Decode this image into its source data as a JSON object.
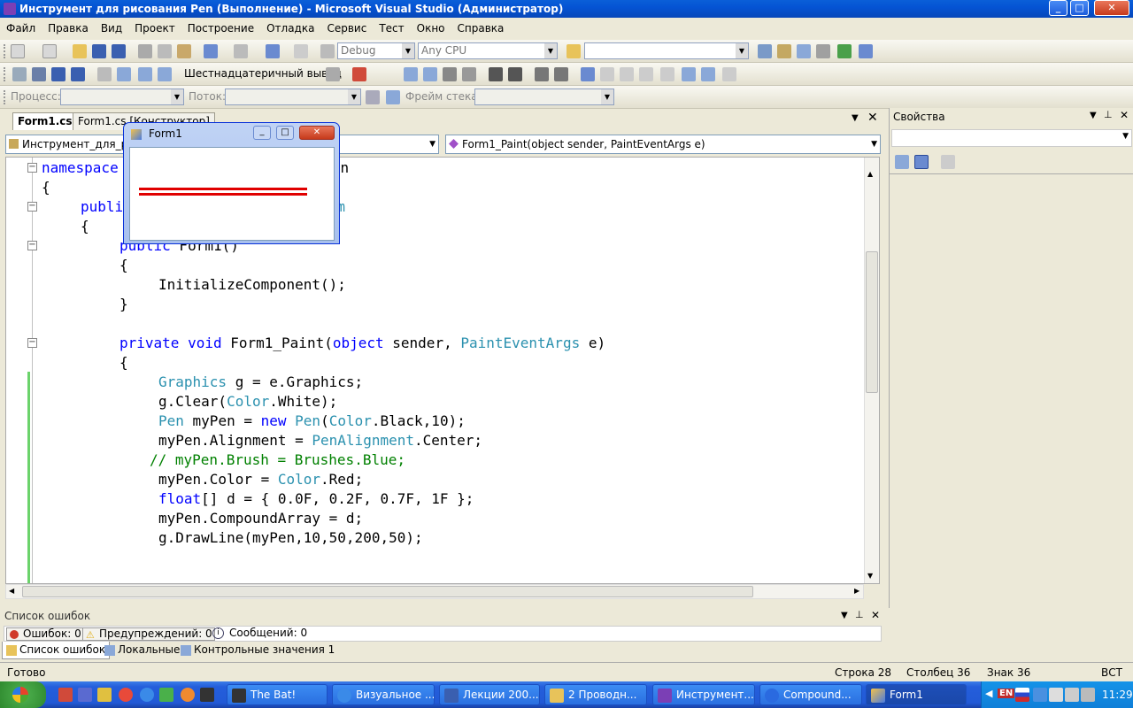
{
  "window": {
    "title": "Инструмент для рисования Pen (Выполнение) - Microsoft Visual Studio (Администратор)",
    "minimize": "_",
    "maximize": "□",
    "close": "✕"
  },
  "menu": [
    "Файл",
    "Правка",
    "Вид",
    "Проект",
    "Построение",
    "Отладка",
    "Сервис",
    "Тест",
    "Окно",
    "Справка"
  ],
  "toolbar1": {
    "config": "Debug",
    "platform": "Any CPU"
  },
  "toolbar2": {
    "hex_label": "Шестнадцатеричный вывод"
  },
  "toolbar3": {
    "process_label": "Процесс:",
    "thread_label": "Поток:",
    "stack_label": "Фрейм стека:"
  },
  "tabs": [
    "Form1.cs",
    "Form1.cs [Конструктор]"
  ],
  "nav": {
    "left": "Инструмент_для_ри",
    "right": "Form1_Paint(object sender, PaintEventArgs e)"
  },
  "form1": {
    "title": "Form1"
  },
  "code": {
    "l1a": "namespace",
    "l1b": "ния_Pen",
    "l2": "{",
    "l3a": "publi",
    "l3b": ": ",
    "l3c": "Form",
    "l4": "{",
    "l5a": "public",
    "l5b": " Form1()",
    "l6": "{",
    "l7": "InitializeComponent();",
    "l8": "}",
    "l9a": "private",
    "l9b": "void",
    "l9c": " Form1_Paint(",
    "l9d": "object",
    "l9e": " sender, ",
    "l9f": "PaintEventArgs",
    "l9g": " e)",
    "l10": "{",
    "l11a": "Graphics",
    "l11b": " g = e.Graphics;",
    "l12a": "g.Clear(",
    "l12b": "Color",
    "l12c": ".White);",
    "l13a": "Pen",
    "l13b": " myPen = ",
    "l13c": "new",
    "l13d": " ",
    "l13e": "Pen",
    "l13f": "(",
    "l13g": "Color",
    "l13h": ".Black,10);",
    "l14a": "myPen.Alignment = ",
    "l14b": "PenAlignment",
    "l14c": ".Center;",
    "l15": "// myPen.Brush = Brushes.Blue;",
    "l16a": "myPen.Color = ",
    "l16b": "Color",
    "l16c": ".Red;",
    "l17a": "float",
    "l17b": "[] d = { 0.0F, 0.2F, 0.7F, 1F };",
    "l18": "myPen.CompoundArray = d;",
    "l19": "g.DrawLine(myPen,10,50,200,50);"
  },
  "properties": {
    "title": "Свойства"
  },
  "errors": {
    "title": "Список ошибок",
    "errors": "Ошибок: 0",
    "warnings": "Предупреждений: 0",
    "messages": "Сообщений: 0",
    "tabs": [
      "Список ошибок",
      "Локальные",
      "Контрольные значения 1"
    ]
  },
  "status": {
    "ready": "Готово",
    "line": "Строка 28",
    "col": "Столбец 36",
    "ch": "Знак 36",
    "ins": "ВСТ"
  },
  "taskbar": {
    "items": [
      "The Bat!",
      "Визуальное ...",
      "Лекции 200...",
      "2 Проводн...",
      "Инструмент...",
      "Compound...",
      "Form1"
    ],
    "lang": "EN",
    "time": "11:29"
  }
}
